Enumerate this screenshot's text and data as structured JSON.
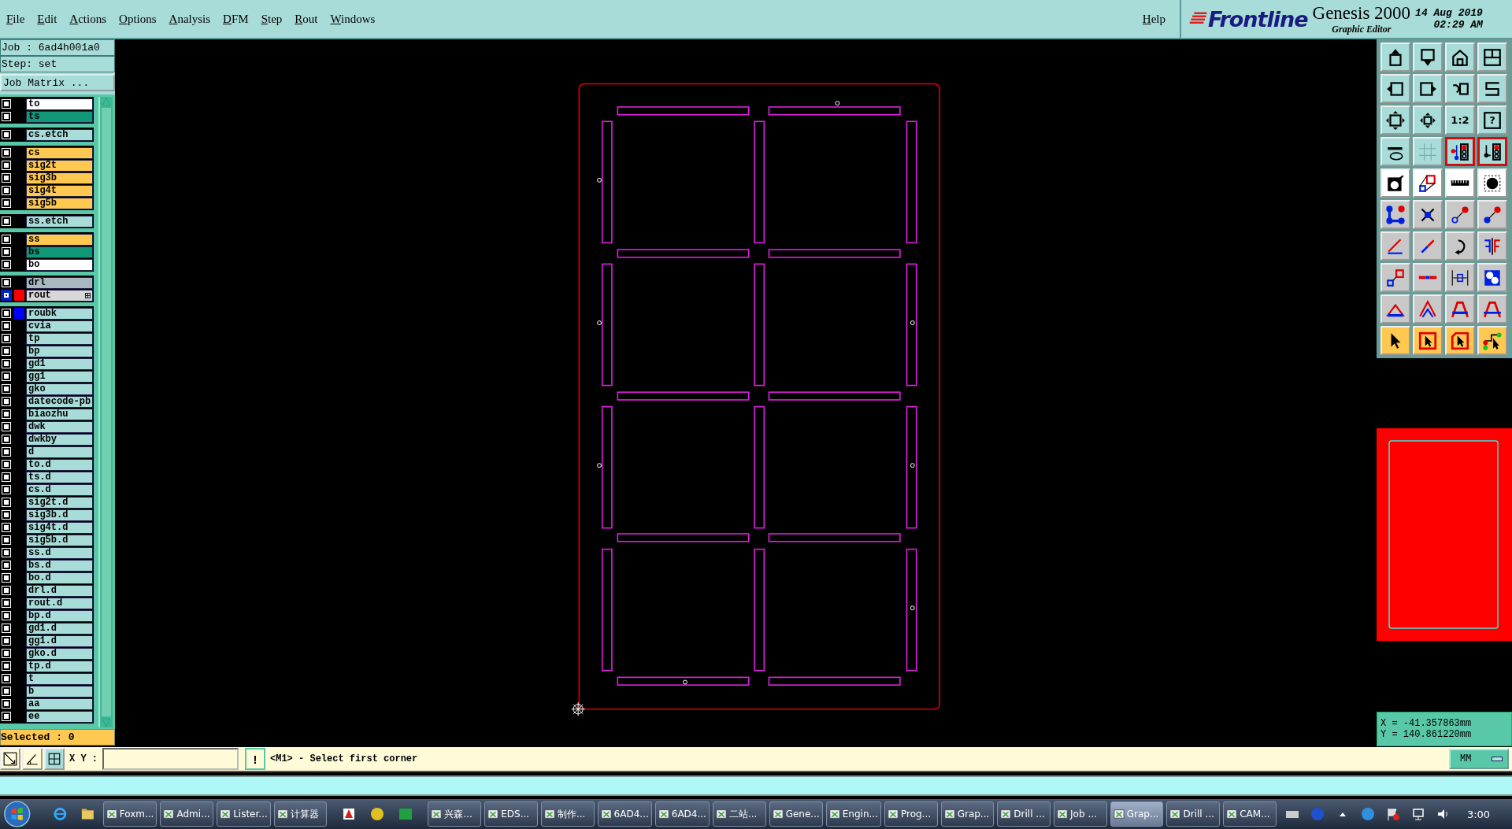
{
  "menu": [
    "File",
    "Edit",
    "Actions",
    "Options",
    "Analysis",
    "DFM",
    "Step",
    "Rout",
    "Windows"
  ],
  "help": "Help",
  "brand": {
    "logo": "Frontline",
    "product": "Genesis 2000",
    "subtitle": "Graphic Editor",
    "date": "14 Aug 2019",
    "time": "02:29 AM"
  },
  "job": "Job : 6ad4h001a0",
  "step": "Step: set",
  "job_matrix": "Job Matrix ...",
  "layer_groups": [
    [
      {
        "name": "to",
        "kind": "silk",
        "selected": false
      },
      {
        "name": "ts",
        "kind": "solder",
        "selected": false
      }
    ],
    [
      {
        "name": "cs.etch",
        "kind": "misc",
        "selected": false
      }
    ],
    [
      {
        "name": "cs",
        "kind": "signal",
        "selected": false
      },
      {
        "name": "sig2t",
        "kind": "signal",
        "selected": false
      },
      {
        "name": "sig3b",
        "kind": "signal",
        "selected": false
      },
      {
        "name": "sig4t",
        "kind": "signal",
        "selected": false
      },
      {
        "name": "sig5b",
        "kind": "signal",
        "selected": false
      }
    ],
    [
      {
        "name": "ss.etch",
        "kind": "misc",
        "selected": false
      }
    ],
    [
      {
        "name": "ss",
        "kind": "signal",
        "selected": false
      },
      {
        "name": "bs",
        "kind": "solder",
        "selected": false
      },
      {
        "name": "bo",
        "kind": "silk",
        "selected": false
      }
    ],
    [
      {
        "name": "drl",
        "kind": "drill",
        "selected": false
      },
      {
        "name": "rout",
        "kind": "rout",
        "selected": true,
        "color": "#ff0000"
      }
    ],
    [
      {
        "name": "roubk",
        "kind": "misc",
        "selected": false,
        "color": "#0000ff"
      },
      {
        "name": "cvia",
        "kind": "misc",
        "selected": false
      },
      {
        "name": "tp",
        "kind": "misc",
        "selected": false
      },
      {
        "name": "bp",
        "kind": "misc",
        "selected": false
      },
      {
        "name": "gd1",
        "kind": "misc",
        "selected": false
      },
      {
        "name": "gg1",
        "kind": "misc",
        "selected": false
      },
      {
        "name": "gko",
        "kind": "misc",
        "selected": false
      },
      {
        "name": "datecode-pb",
        "kind": "misc",
        "selected": false
      },
      {
        "name": "biaozhu",
        "kind": "misc",
        "selected": false
      },
      {
        "name": "dwk",
        "kind": "misc",
        "selected": false
      },
      {
        "name": "dwkby",
        "kind": "misc",
        "selected": false
      },
      {
        "name": "d",
        "kind": "misc",
        "selected": false
      },
      {
        "name": "to.d",
        "kind": "misc",
        "selected": false
      },
      {
        "name": "ts.d",
        "kind": "misc",
        "selected": false
      },
      {
        "name": "cs.d",
        "kind": "misc",
        "selected": false
      },
      {
        "name": "sig2t.d",
        "kind": "misc",
        "selected": false
      },
      {
        "name": "sig3b.d",
        "kind": "misc",
        "selected": false
      },
      {
        "name": "sig4t.d",
        "kind": "misc",
        "selected": false
      },
      {
        "name": "sig5b.d",
        "kind": "misc",
        "selected": false
      },
      {
        "name": "ss.d",
        "kind": "misc",
        "selected": false
      },
      {
        "name": "bs.d",
        "kind": "misc",
        "selected": false
      },
      {
        "name": "bo.d",
        "kind": "misc",
        "selected": false
      },
      {
        "name": "drl.d",
        "kind": "misc",
        "selected": false
      },
      {
        "name": "rout.d",
        "kind": "misc",
        "selected": false
      },
      {
        "name": "bp.d",
        "kind": "misc",
        "selected": false
      },
      {
        "name": "gd1.d",
        "kind": "misc",
        "selected": false
      },
      {
        "name": "gg1.d",
        "kind": "misc",
        "selected": false
      },
      {
        "name": "gko.d",
        "kind": "misc",
        "selected": false
      },
      {
        "name": "tp.d",
        "kind": "misc",
        "selected": false
      },
      {
        "name": "t",
        "kind": "misc",
        "selected": false
      },
      {
        "name": "b",
        "kind": "misc",
        "selected": false
      },
      {
        "name": "aa",
        "kind": "misc",
        "selected": false
      },
      {
        "name": "ee",
        "kind": "misc",
        "selected": false
      }
    ]
  ],
  "selected_count": "Selected : 0",
  "tool_texts": [
    "1:2",
    "?"
  ],
  "coordinates": {
    "x": "X = -41.357863mm",
    "y": "Y = 140.861220mm"
  },
  "command": {
    "label": "X Y :",
    "button": "!",
    "prompt": "<M1> - Select first corner",
    "units": "MM"
  },
  "taskbar": {
    "items": [
      {
        "label": "Foxm...",
        "selected": false
      },
      {
        "label": "Admi...",
        "selected": false
      },
      {
        "label": "Lister...",
        "selected": false
      },
      {
        "label": "计算器",
        "selected": false
      },
      {
        "kind": "quick"
      },
      {
        "label": "兴森...",
        "selected": false
      },
      {
        "label": "EDS...",
        "selected": false
      },
      {
        "label": "制作...",
        "selected": false
      },
      {
        "label": "6AD4...",
        "selected": false
      },
      {
        "label": "6AD4...",
        "selected": false
      },
      {
        "label": "二站...",
        "selected": false
      },
      {
        "label": "Gene...",
        "selected": false
      },
      {
        "label": "Engin...",
        "selected": false
      },
      {
        "label": "Prog...",
        "selected": false
      },
      {
        "label": "Grap...",
        "selected": false
      },
      {
        "label": "Drill ...",
        "selected": false
      },
      {
        "label": "Job ...",
        "selected": false
      },
      {
        "label": "Grap...",
        "selected": true
      },
      {
        "label": "Drill ...",
        "selected": false
      },
      {
        "label": "CAM...",
        "selected": false
      }
    ],
    "clock": "3:00"
  }
}
